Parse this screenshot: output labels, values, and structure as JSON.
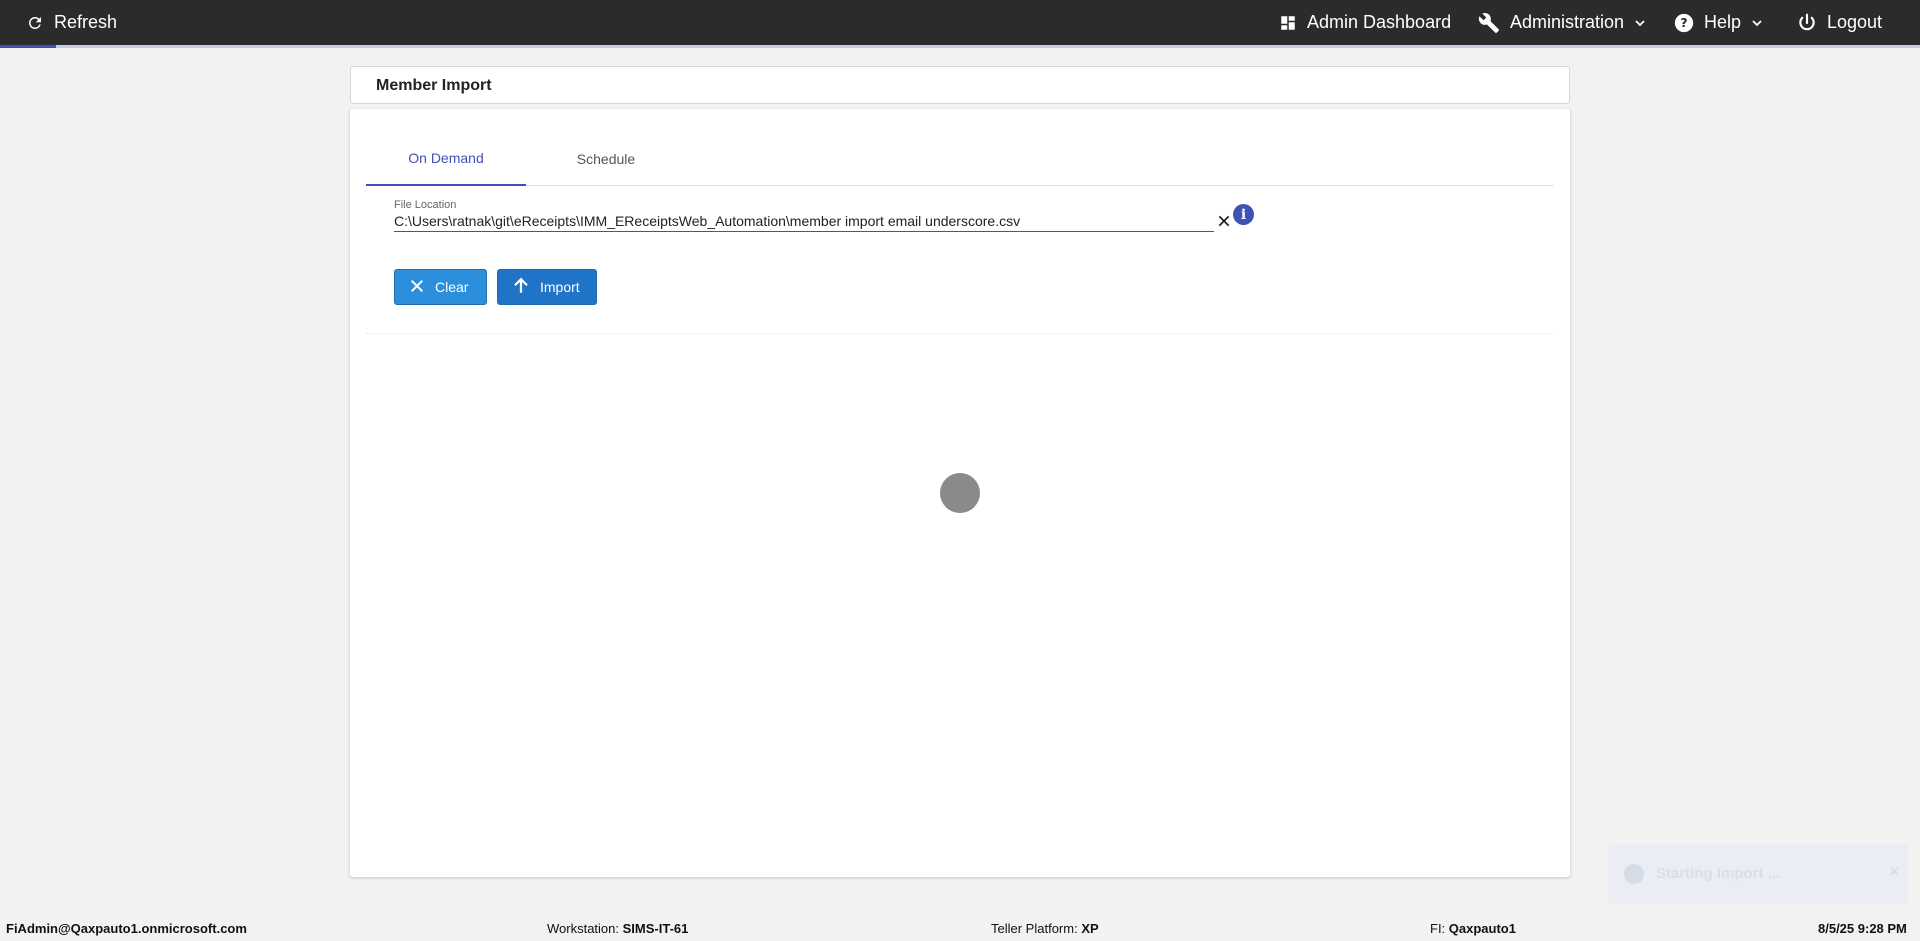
{
  "topbar": {
    "refresh_label": "Refresh",
    "admin_dashboard_label": "Admin Dashboard",
    "administration_label": "Administration",
    "help_label": "Help",
    "logout_label": "Logout"
  },
  "page": {
    "title": "Member Import"
  },
  "tabs": [
    {
      "label": "On Demand",
      "active": true
    },
    {
      "label": "Schedule",
      "active": false
    }
  ],
  "file_field": {
    "label": "File Location",
    "value": "C:\\Users\\ratnak\\git\\eReceipts\\IMM_EReceiptsWeb_Automation\\member import email underscore.csv"
  },
  "buttons": {
    "clear_label": "Clear",
    "import_label": "Import"
  },
  "toast": {
    "message": "Starting Import ..."
  },
  "footer": {
    "user": "FiAdmin@Qaxpauto1.onmicrosoft.com",
    "workstation_label": "Workstation:",
    "workstation_value": "SIMS-IT-61",
    "teller_label": "Teller Platform:",
    "teller_value": "XP",
    "fi_label": "FI:",
    "fi_value": "Qaxpauto1",
    "datetime": "8/5/25 9:28 PM"
  },
  "colors": {
    "accent": "#3f51b5",
    "button": "#2b8fdc",
    "topbar": "#2b2b2b"
  }
}
